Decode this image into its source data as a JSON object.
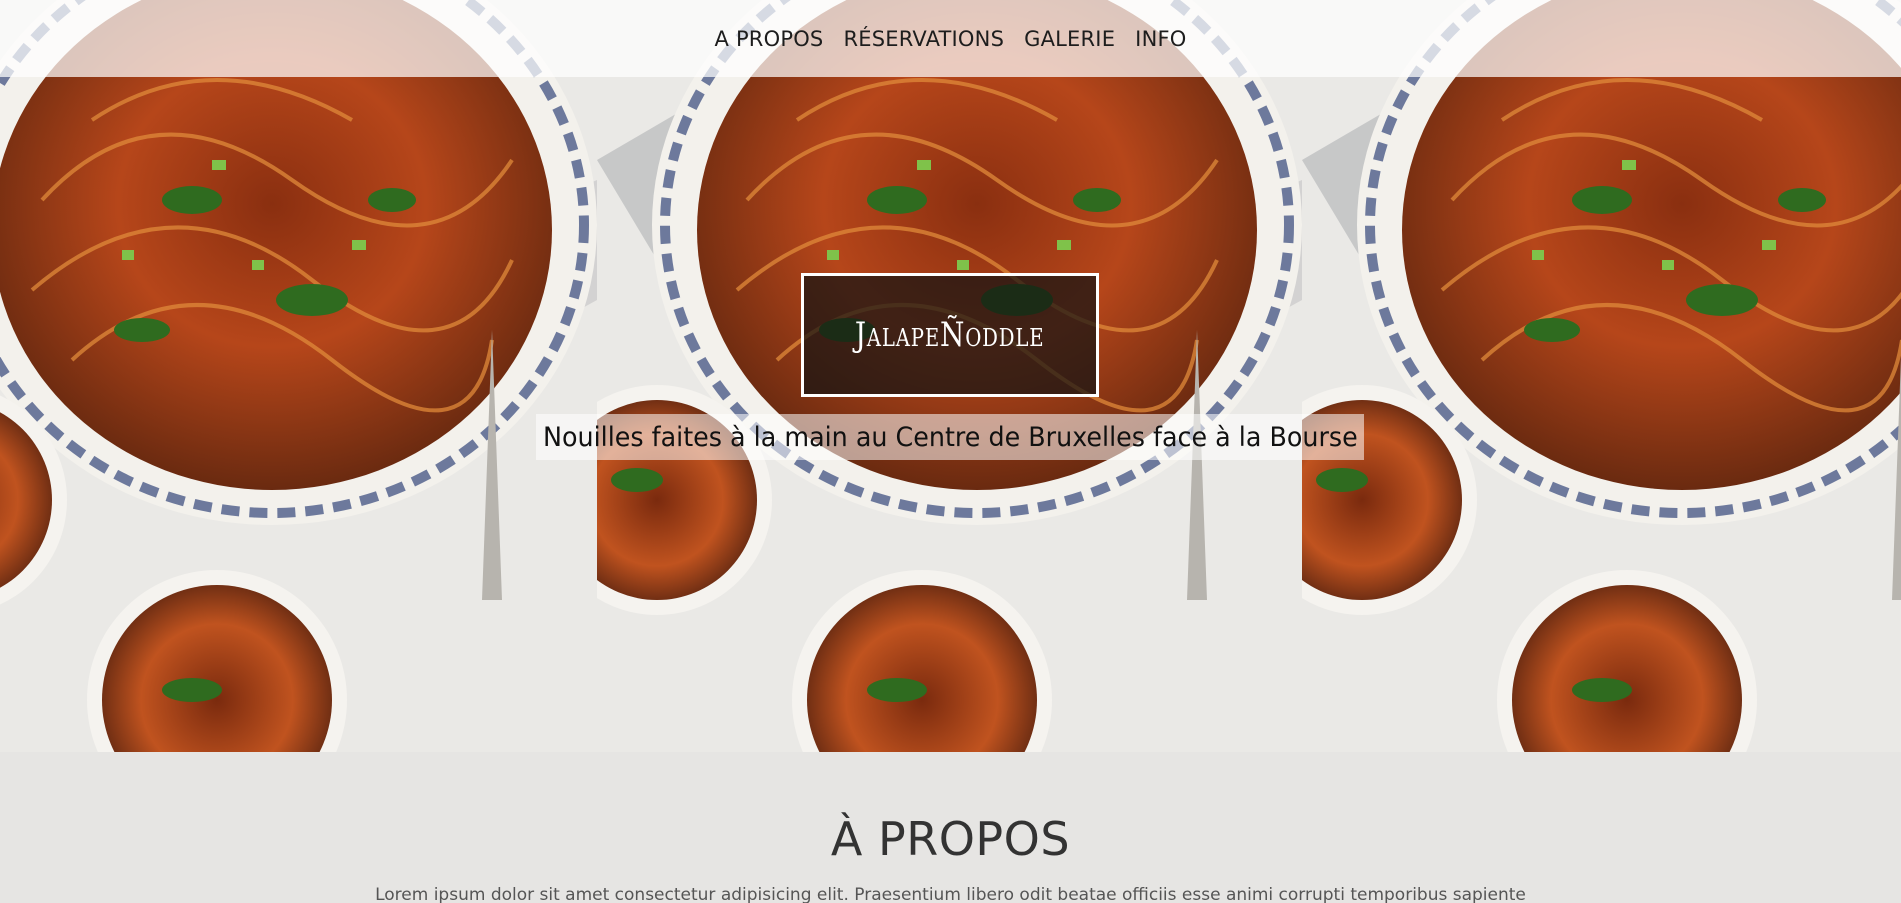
{
  "nav": {
    "items": [
      {
        "label": "A PROPOS"
      },
      {
        "label": "RÉSERVATIONS"
      },
      {
        "label": "GALERIE"
      },
      {
        "label": "INFO"
      }
    ]
  },
  "hero": {
    "brand": "JalapeÑoddle",
    "tagline": "Nouilles faites à la main au Centre de Bruxelles face à la Bourse",
    "image_description_icon": "noodle-bowl-photo"
  },
  "about": {
    "title": "À PROPOS",
    "text": "Lorem ipsum dolor sit amet consectetur adipisicing elit. Praesentium libero odit beatae officiis esse animi corrupti temporibus sapiente"
  },
  "colors": {
    "navbar_bg": "#ffffffb8",
    "brand_border": "#ffffff",
    "section_bg": "#e6e5e3",
    "noodle": "#c8501e"
  }
}
